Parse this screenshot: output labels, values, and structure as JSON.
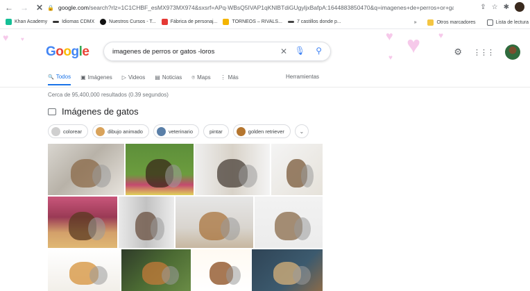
{
  "browser": {
    "url_host": "google.com",
    "url_rest": "/search?rlz=1C1CHBF_esMX973MX974&sxsrf=APq-WBsQ5IVAP1qKNlBTdiGUgyljxBafpA:1644883850470&q=imagenes+de+perros+or+gatos..."
  },
  "bookmarks": [
    {
      "label": "Khan Academy",
      "color": "#14bf96"
    },
    {
      "label": "Idiomas CDMX",
      "color": "#333333"
    },
    {
      "label": "Nuestros Cursos - T...",
      "color": "#111111"
    },
    {
      "label": "Fábrica de personaj...",
      "color": "#e53935"
    },
    {
      "label": "TORNEOS – RIVALS...",
      "color": "#f4b400"
    },
    {
      "label": "7 castillos donde p...",
      "color": "#444444"
    }
  ],
  "bookmarks_right": {
    "more": "»",
    "other": "Otros marcadores",
    "reading": "Lista de lectura"
  },
  "search": {
    "query": "imagenes de perros or gatos -loros"
  },
  "logo": {
    "g1": "G",
    "o1": "o",
    "o2": "o",
    "g2": "g",
    "l": "l",
    "e": "e"
  },
  "tabs": [
    {
      "icon": "🔍",
      "label": "Todos",
      "active": true
    },
    {
      "icon": "▣",
      "label": "Imágenes",
      "active": false
    },
    {
      "icon": "▷",
      "label": "Videos",
      "active": false
    },
    {
      "icon": "▤",
      "label": "Noticias",
      "active": false
    },
    {
      "icon": "⌾",
      "label": "Maps",
      "active": false
    },
    {
      "icon": "⋮",
      "label": "Más",
      "active": false
    }
  ],
  "tools_label": "Herramientas",
  "results_count": "Cerca de 95,400,000 resultados (0.39 segundos)",
  "section_title": "Imágenes de gatos",
  "chips": [
    {
      "label": "colorear",
      "thumb": "#cfcfcf"
    },
    {
      "label": "dibujo animado",
      "thumb": "#d9a35b"
    },
    {
      "label": "veterinario",
      "thumb": "#5a7fa8"
    },
    {
      "label": "pintar",
      "thumb": ""
    },
    {
      "label": "golden retriever",
      "thumb": "#b5762f"
    }
  ],
  "chip_more": "⌄",
  "images": [
    {
      "bg": "linear-gradient(135deg,#d9d6d0 0%,#b8b2a8 45%,#e8e4de 100%)",
      "accent": "#8b6a48"
    },
    {
      "bg": "linear-gradient(180deg,#5d8f3a 0%,#6c9c3e 60%,#c44a6f 80%,#e0d25a 100%)",
      "accent": "#3a2a1a"
    },
    {
      "bg": "linear-gradient(90deg,#efefef 0%,#d8d2c8 50%,#f4f4f4 100%)",
      "accent": "#4a4038"
    },
    {
      "bg": "linear-gradient(135deg,#f4f4f4 0%,#e6e2da 100%)",
      "accent": "#7a5a3a"
    },
    {
      "bg": "linear-gradient(180deg,#c9567b 0%,#9a3a55 40%,#d3a06a 70%,#e0b874 100%)",
      "accent": "#5a3a20"
    },
    {
      "bg": "linear-gradient(90deg,#e9e9e9 0%,#c2c2c2 50%,#ececec 100%)",
      "accent": "#6a5040"
    },
    {
      "bg": "linear-gradient(180deg,#e6e6e6 0%,#d9d5cf 60%,#c7b7a0 100%)",
      "accent": "#a9743e"
    },
    {
      "bg": "linear-gradient(180deg,#f2f2f2 0%,#ececec 100%)",
      "accent": "#8a6b4a"
    },
    {
      "bg": "linear-gradient(180deg,#ffffff 0%,#f2efe9 100%)",
      "accent": "#d6913a"
    },
    {
      "bg": "linear-gradient(135deg,#2f3b2a 0%,#4b6a33 50%,#6a8c46 100%)",
      "accent": "#c47a3a"
    },
    {
      "bg": "linear-gradient(180deg,#fffaf2 0%,#ffffff 100%)",
      "accent": "#8a4b1c"
    },
    {
      "bg": "linear-gradient(135deg,#2f4456 0%,#3c5a6e 60%,#8a6b4a 100%)",
      "accent": "#d8b27a"
    }
  ]
}
